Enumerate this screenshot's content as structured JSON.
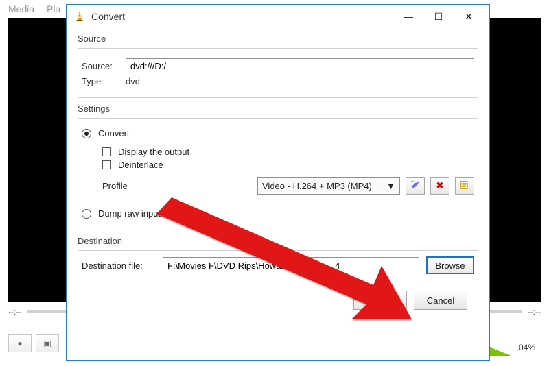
{
  "bg": {
    "menu": {
      "media": "Media",
      "playback": "Pla"
    },
    "time_left": "--:--",
    "time_right": "--:--",
    "volume_text": ".04%"
  },
  "dialog": {
    "title": "Convert",
    "source": {
      "label": "Source",
      "source_lbl": "Source:",
      "source_val": "dvd:///D:/",
      "type_lbl": "Type:",
      "type_val": "dvd"
    },
    "settings": {
      "label": "Settings",
      "convert": "Convert",
      "display_output": "Display the output",
      "deinterlace": "Deinterlace",
      "profile_lbl": "Profile",
      "profile_val": "Video - H.264 + MP3 (MP4)",
      "dump_raw": "Dump raw input"
    },
    "destination": {
      "label": "Destination",
      "file_lbl": "Destination file:",
      "file_val": "F:\\Movies F\\DVD Rips\\Howard the D         4",
      "browse": "Browse"
    },
    "buttons": {
      "start": "Start",
      "cancel": "Cancel"
    }
  }
}
